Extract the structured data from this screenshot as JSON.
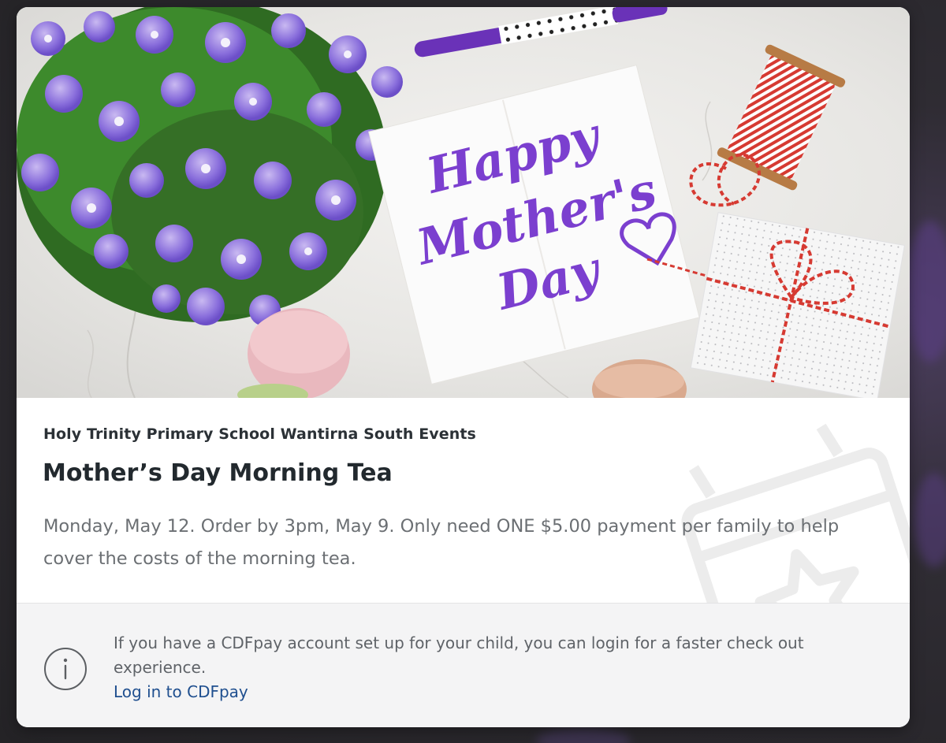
{
  "hero": {
    "image_description": "Mother's Day flat-lay: purple flowers, card, gift box and twine",
    "card_text_line1": "Happy",
    "card_text_line2": "Mother's",
    "card_text_line3": "Day"
  },
  "event": {
    "organization": "Holy Trinity Primary School Wantirna South Events",
    "title": "Mother’s Day Morning Tea",
    "description": "Monday, May 12. Order by 3pm, May 9. Only need ONE $5.00 payment per family to help cover the costs of the morning tea."
  },
  "login_notice": {
    "icon": "info-icon",
    "message": "If you have a CDFpay account set up for your child, you can login for a faster check out experience.",
    "link_label": "Log in to CDFpay"
  },
  "colors": {
    "card_bg": "#ffffff",
    "panel_bg": "#f4f4f5",
    "title_text": "#22292e",
    "body_text": "#6b6f73",
    "link": "#1f4f8f",
    "accent_purple": "#7b3fcf"
  }
}
